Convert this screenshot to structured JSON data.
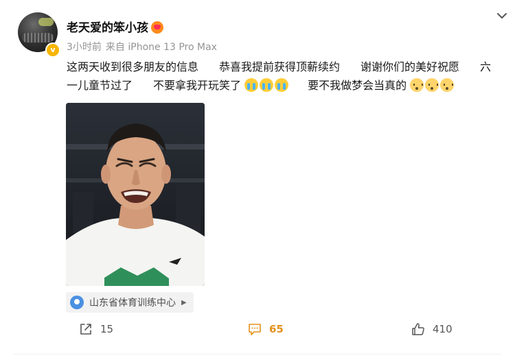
{
  "post": {
    "username": "老天爱的笨小孩",
    "time": "3小时前",
    "source": "来自 iPhone 13 Pro Max",
    "line1_segments": [
      "这两天收到很多朋友的信息",
      "恭喜我提前获得顶薪续约",
      "谢谢你们的美好祝愿",
      "六"
    ],
    "line2_a": "一儿童节过了",
    "line2_b": "不要拿我开玩笑了",
    "line2_c": "要不我做梦会当真的",
    "emojis": {
      "cry": "cry-emoji",
      "dull": "dull-face-emoji"
    },
    "location": "山东省体育训练中心"
  },
  "actions": {
    "repost_count": "15",
    "comment_count": "65",
    "like_count": "410"
  },
  "colors": {
    "accent": "#e5911c",
    "verified": "#f7b500",
    "location_icon": "#4a90e2",
    "meta_gray": "#939393"
  }
}
